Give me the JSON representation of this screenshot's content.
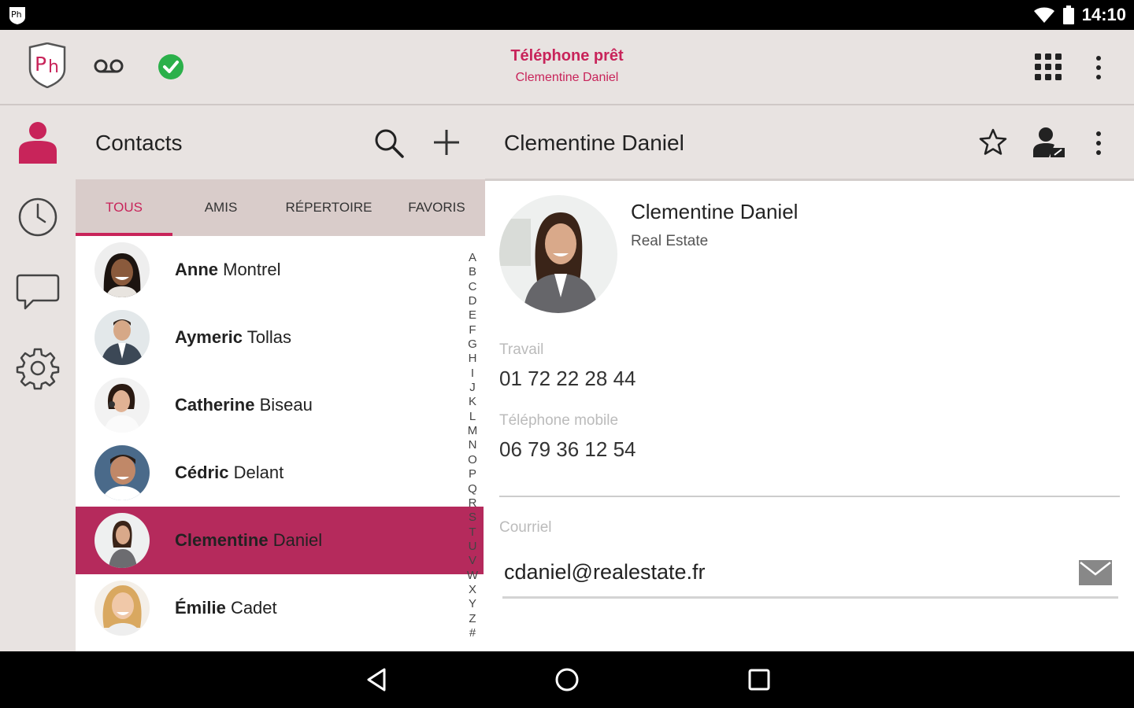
{
  "status_bar": {
    "time": "14:10"
  },
  "top_bar": {
    "phone_status_title": "Téléphone prêt",
    "phone_status_user": "Clementine Daniel",
    "colors": {
      "accent": "#c8245a",
      "status_ok": "#2bb04a"
    }
  },
  "contacts": {
    "title": "Contacts",
    "tabs": [
      {
        "label": "TOUS",
        "active": true
      },
      {
        "label": "AMIS",
        "active": false
      },
      {
        "label": "RÉPERTOIRE",
        "active": false
      },
      {
        "label": "FAVORIS",
        "active": false
      }
    ],
    "items": [
      {
        "first": "Anne",
        "last": "Montrel",
        "selected": false
      },
      {
        "first": "Aymeric",
        "last": "Tollas",
        "selected": false
      },
      {
        "first": "Catherine",
        "last": "Biseau",
        "selected": false
      },
      {
        "first": "Cédric",
        "last": "Delant",
        "selected": false
      },
      {
        "first": "Clementine",
        "last": "Daniel",
        "selected": true
      },
      {
        "first": "Émilie",
        "last": "Cadet",
        "selected": false
      }
    ],
    "alphabet": [
      "A",
      "B",
      "C",
      "D",
      "E",
      "F",
      "G",
      "H",
      "I",
      "J",
      "K",
      "L",
      "M",
      "N",
      "O",
      "P",
      "Q",
      "R",
      "S",
      "T",
      "U",
      "V",
      "W",
      "X",
      "Y",
      "Z",
      "#"
    ]
  },
  "detail": {
    "title": "Clementine Daniel",
    "name": "Clementine Daniel",
    "company": "Real Estate",
    "work_label": "Travail",
    "work_phone": "01 72 22 28 44",
    "mobile_label": "Téléphone mobile",
    "mobile_phone": "06 79 36 12 54",
    "email_label": "Courriel",
    "email": "cdaniel@realestate.fr"
  }
}
